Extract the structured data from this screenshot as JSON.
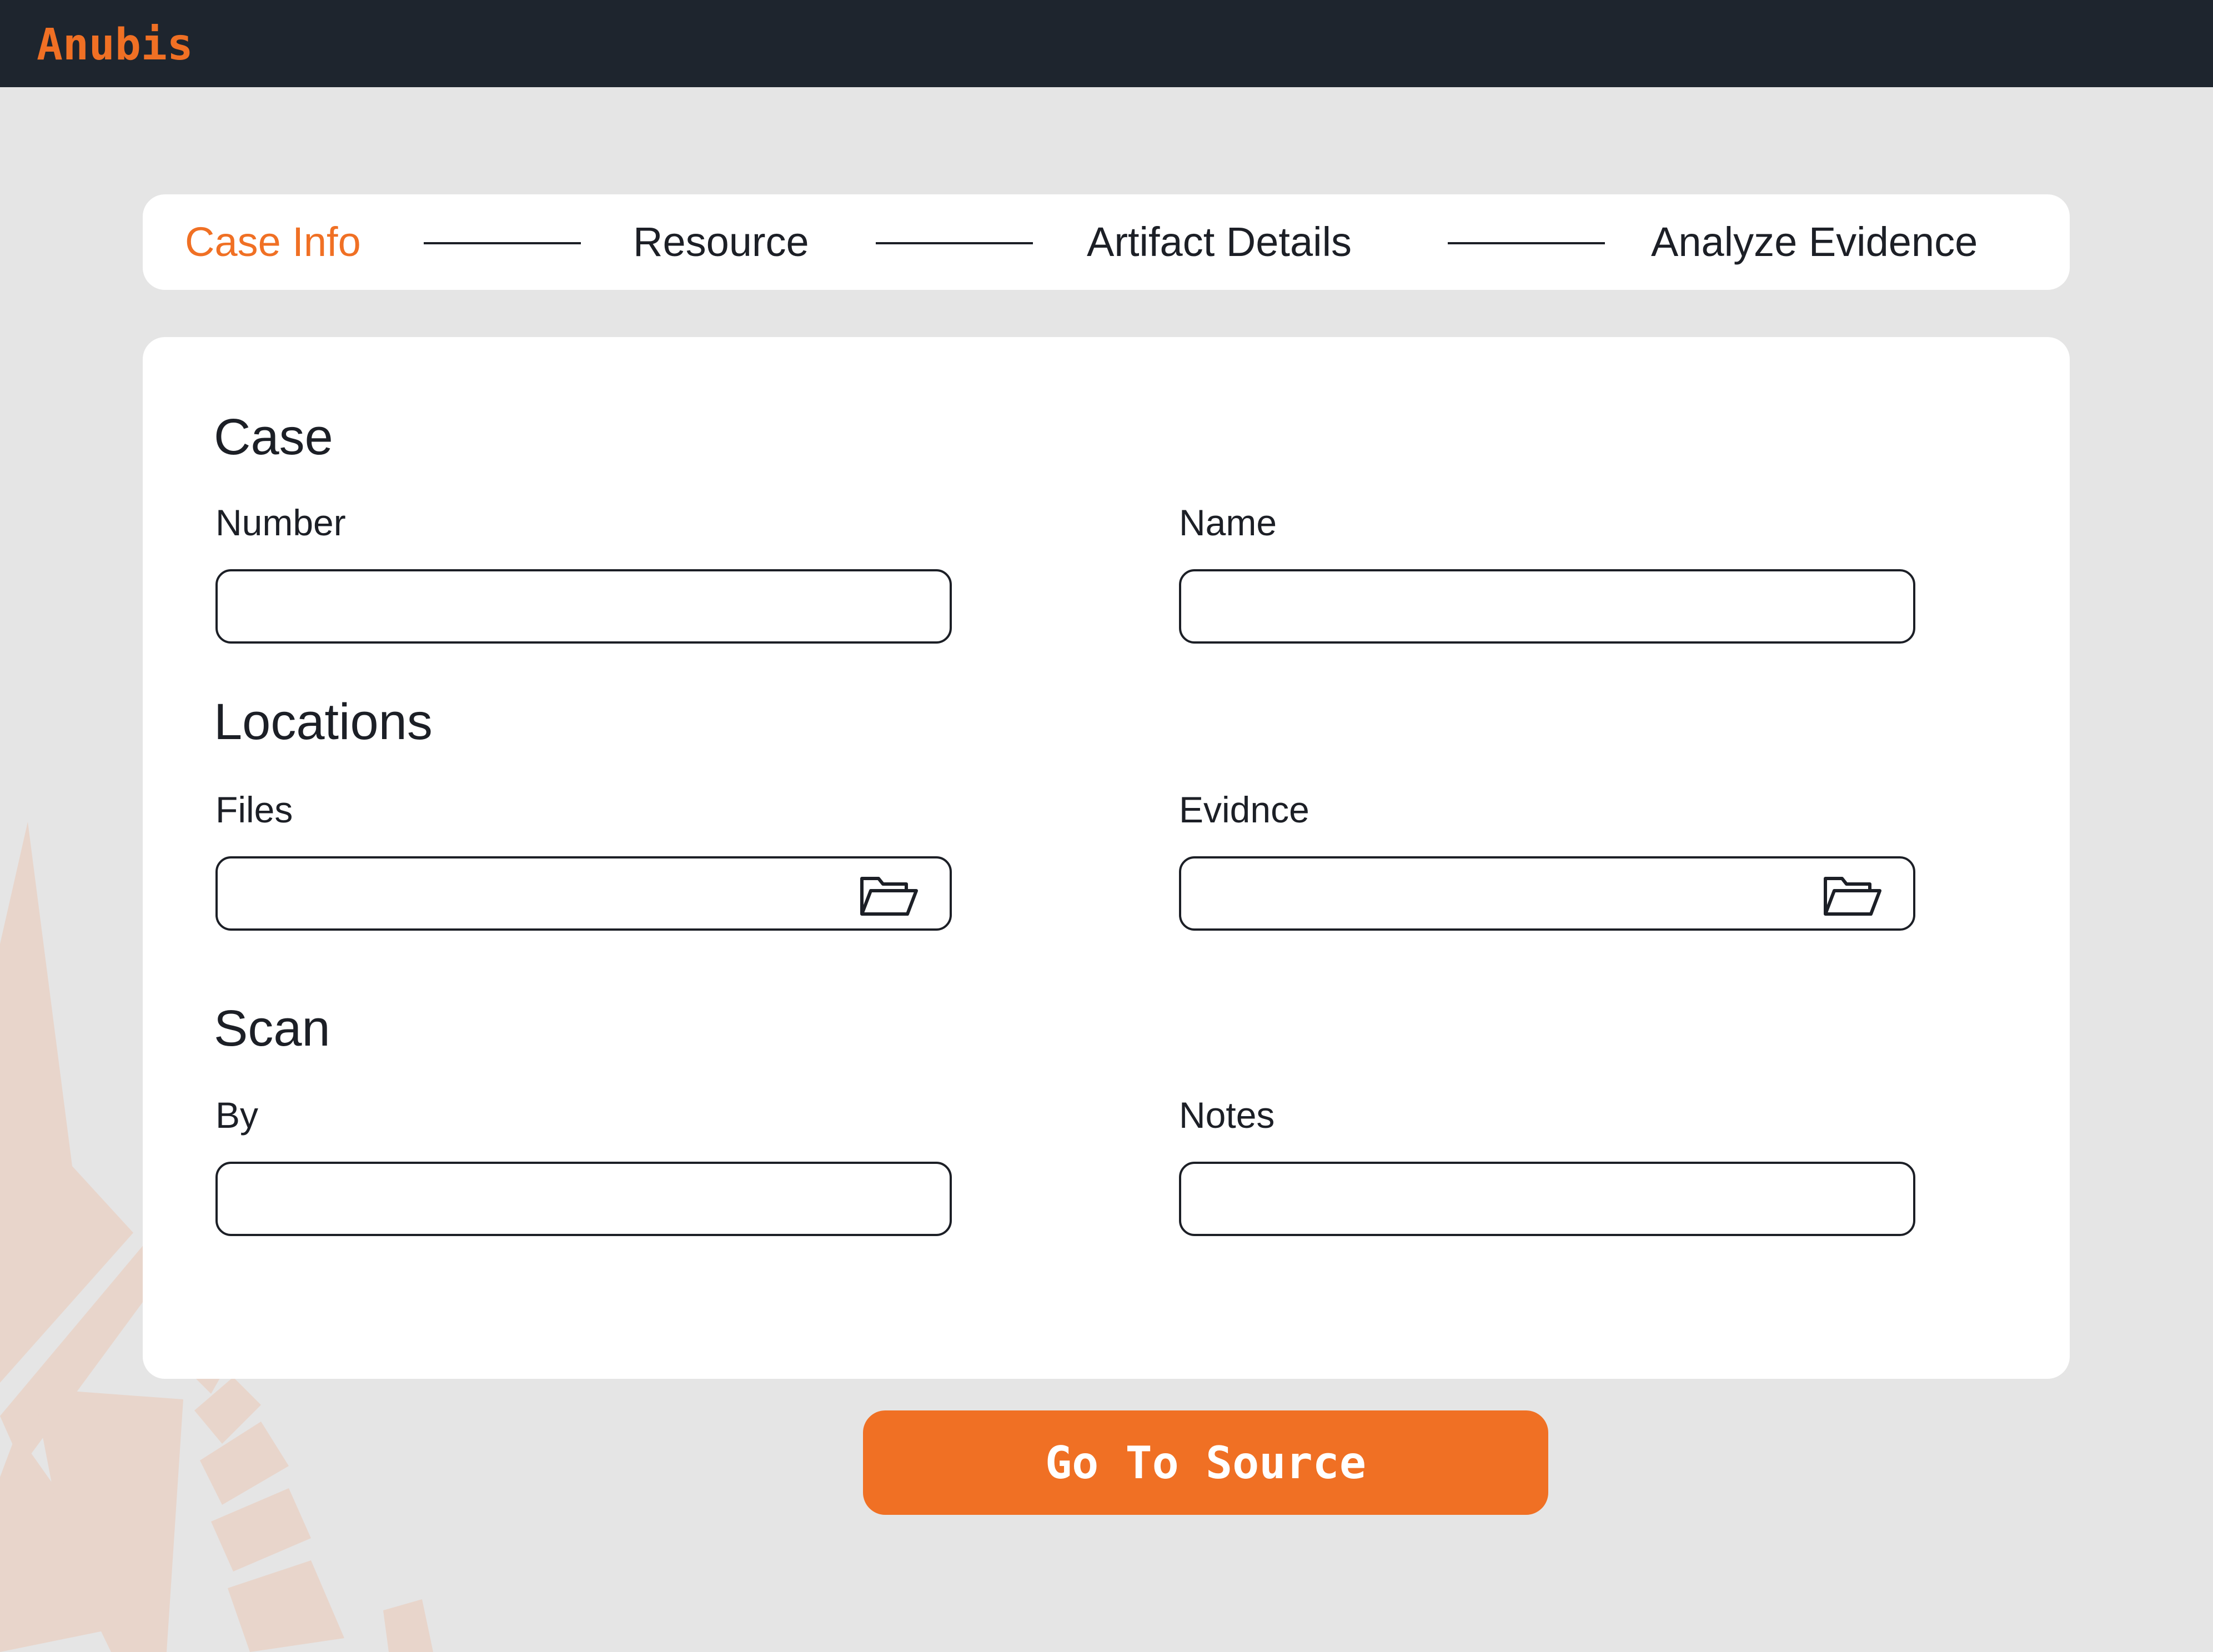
{
  "app": {
    "title": "Anubis"
  },
  "stepper": {
    "steps": [
      {
        "label": "Case Info",
        "active": true
      },
      {
        "label": "Resource",
        "active": false
      },
      {
        "label": "Artifact Details",
        "active": false
      },
      {
        "label": "Analyze Evidence",
        "active": false
      }
    ]
  },
  "form": {
    "case": {
      "title": "Case",
      "number": {
        "label": "Number",
        "value": "",
        "placeholder": ""
      },
      "name": {
        "label": "Name",
        "value": "",
        "placeholder": ""
      }
    },
    "locations": {
      "title": "Locations",
      "files": {
        "label": "Files",
        "value": "",
        "placeholder": "",
        "icon": "folder-open-icon"
      },
      "evidence": {
        "label": "Evidnce",
        "value": "",
        "placeholder": "",
        "icon": "folder-open-icon"
      }
    },
    "scan": {
      "title": "Scan",
      "by": {
        "label": "By",
        "value": "",
        "placeholder": ""
      },
      "notes": {
        "label": "Notes",
        "value": "",
        "placeholder": ""
      }
    }
  },
  "actions": {
    "go_to_source_label": "Go To Source"
  },
  "colors": {
    "accent": "#f07024",
    "topbar": "#1e252e",
    "background": "#e5e5e5",
    "card": "#ffffff",
    "text": "#1c1f26",
    "watermark": "#e8d5cb"
  }
}
